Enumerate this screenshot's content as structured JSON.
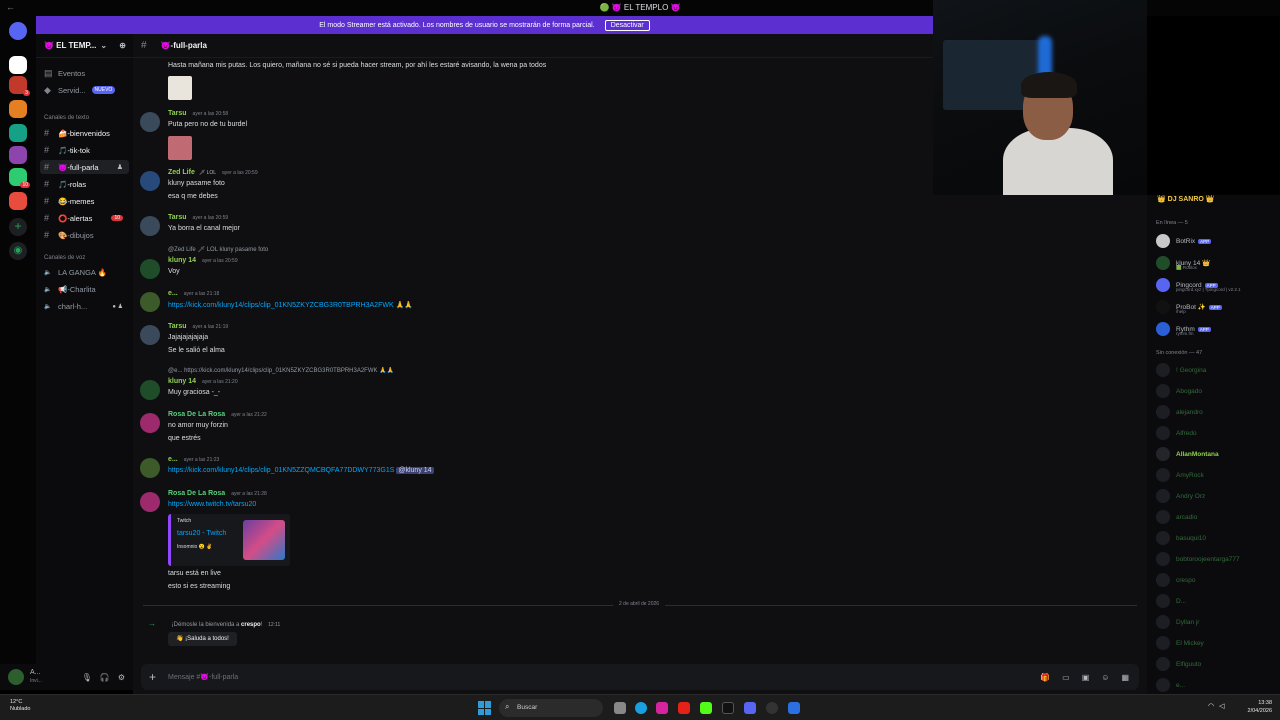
{
  "window": {
    "title": "🟢 👿 EL TEMPLO 👿"
  },
  "banner": {
    "text": "El modo Streamer está activado. Los nombres de usuario se mostrarán de forma parcial.",
    "button": "Desactivar"
  },
  "server": {
    "name": "👿 EL TEMP...",
    "chevron": "⌄",
    "invite_icon": "person-add-icon"
  },
  "rail": {
    "servers": [
      {
        "color": "#ffffff",
        "badge": ""
      },
      {
        "color": "#c0392b",
        "badge": "3"
      },
      {
        "color": "#e67e22",
        "badge": ""
      },
      {
        "color": "#16a085",
        "badge": ""
      },
      {
        "color": "#8e44ad",
        "badge": ""
      },
      {
        "color": "#2ecc71",
        "badge": "10"
      },
      {
        "color": "#e74c3c",
        "badge": ""
      }
    ]
  },
  "sidebar": {
    "events": "Eventos",
    "servers_label": "Servid...",
    "new_badge": "NUEVO",
    "text_category": "Canales de texto",
    "text_channels": [
      {
        "name": "🍰-bienvenidos",
        "active": false,
        "unread": true
      },
      {
        "name": "🎵-tik-tok",
        "active": false,
        "unread": true
      },
      {
        "name": "👿-full-parla",
        "active": true,
        "unread": true
      },
      {
        "name": "🎵-rolas",
        "active": false,
        "unread": true
      },
      {
        "name": "😂-memes",
        "active": false,
        "unread": true
      },
      {
        "name": "⭕-alertas",
        "active": false,
        "unread": true,
        "mentions": "10"
      },
      {
        "name": "🎨-dibujos",
        "active": false,
        "unread": false
      }
    ],
    "voice_category": "Canales de voz",
    "voice_channels": [
      {
        "name": "LA GANGA 🔥"
      },
      {
        "name": "📢-Charlita"
      },
      {
        "name": "charl-h..."
      }
    ]
  },
  "user_panel": {
    "name": "A...",
    "status": "Invi..."
  },
  "chat": {
    "channel": "👿-full-parla",
    "messages": [
      {
        "author": "",
        "time": "",
        "lines": [
          "Hasta mañana mis putas. Los quiero, mañana no sé si pueda hacer stream, por ahí les estaré avisando, la wena pa todos"
        ]
      },
      {
        "author": "Tarsu",
        "time": "ayer a las 20:58",
        "lines": [
          "Puta pero no de tu burdel"
        ]
      },
      {
        "author": "Zed Life",
        "tag": "🗡 LOL",
        "time": "ayer a las 20:59",
        "lines": [
          "kluny pasame foto",
          "esa q me debes"
        ]
      },
      {
        "author": "Tarsu",
        "time": "ayer a las 20:59",
        "lines": [
          "Ya borra el canal mejor"
        ]
      },
      {
        "reply": "@Zed Life 🗡 LOL kluny pasame foto",
        "author": "kluny 14",
        "time": "ayer a las 20:59",
        "lines": [
          "Voy"
        ]
      },
      {
        "author": "e...",
        "time": "ayer a las 21:18",
        "link": "https://kick.com/kluny14/clips/clip_01KN5ZKYZCBG3R0TBPRH3A2FWK 🙏🙏"
      },
      {
        "author": "Tarsu",
        "time": "ayer a las 21:19",
        "lines": [
          "Jajajajajajaja",
          "Se le salió el alma"
        ]
      },
      {
        "reply": "@e... https://kick.com/kluny14/clips/clip_01KN5ZKYZCBG3R0TBPRH3A2FWK 🙏🙏",
        "author": "kluny 14",
        "time": "ayer a las 21:20",
        "lines": [
          "Muy graciosa -_-"
        ]
      },
      {
        "author": "Rosa De La Rosa",
        "time": "ayer a las 21:22",
        "lines": [
          "no amor muy forzin",
          "que estrés"
        ]
      },
      {
        "author": "e...",
        "time": "ayer a las 21:23",
        "link": "https://kick.com/kluny14/clips/clip_01KN5ZZQMCBQFA77DDWY773G1S",
        "mention": "@kluny 14"
      },
      {
        "author": "Rosa De La Rosa",
        "time": "ayer a las 21:28",
        "link": "https://www.twitch.tv/tarsu20",
        "embed": {
          "provider": "Twitch",
          "title": "tarsu20 - Twitch",
          "desc": "Insomnio 😮 ✌"
        },
        "lines": [
          "tarsu está en live",
          "esto si es streaming"
        ]
      }
    ],
    "date_divider": "2 de abril de 2026",
    "system": {
      "text_pre": "¡Démosle la bienvenida a ",
      "user": "crespo",
      "text_post": "!",
      "time": "12:11",
      "wave": "👋 ¡Saluda a todos!"
    },
    "composer": {
      "placeholder": "Mensaje #👿-full-parla"
    }
  },
  "members": {
    "header": "👑 DJ SANRO 👑",
    "online_label": "En línea — 5",
    "online": [
      {
        "name": "BotRix",
        "app": "APP",
        "sub": ""
      },
      {
        "name": "kluny 14 👑",
        "app": "",
        "sub": "🟩 Roblox"
      },
      {
        "name": "Pingcord",
        "app": "APP",
        "sub": "pingcord.xyz | ?pingcord | v2.2.1"
      },
      {
        "name": "ProBot ✨",
        "app": "APP",
        "sub": "/help"
      },
      {
        "name": "Rythm",
        "app": "APP",
        "sub": "rythm.fm"
      }
    ],
    "offline_label": "Sin conexión — 47",
    "offline": [
      "! Georgina",
      "Abogado",
      "alejandro",
      "Alfredo",
      "AllanMontana",
      "AmyRock",
      "Andry Orz",
      "arcadio",
      "basuqui10",
      "bobtoroojeentarga777",
      "crespo",
      "D...",
      "Dyllan jr",
      "El Mickey",
      "Elfiguuto",
      "e..."
    ]
  },
  "taskbar": {
    "weather_temp": "12°C",
    "weather_desc": "Nublado",
    "search": "Buscar",
    "time": "13:38",
    "date": "2/04/2026"
  }
}
